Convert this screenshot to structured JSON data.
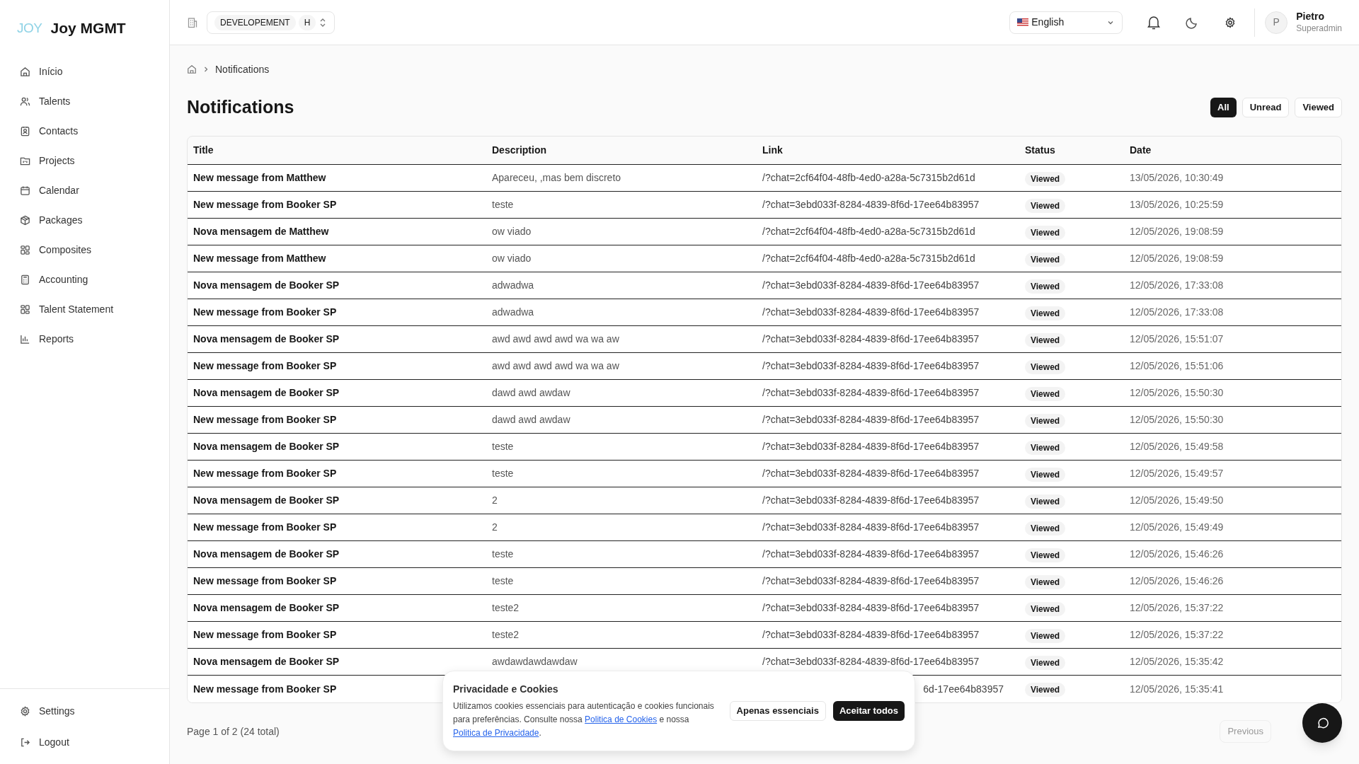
{
  "brand": {
    "mark": "JOY",
    "name": "Joy MGMT"
  },
  "sidebar": {
    "items": [
      {
        "label": "Início"
      },
      {
        "label": "Talents"
      },
      {
        "label": "Contacts"
      },
      {
        "label": "Projects"
      },
      {
        "label": "Calendar"
      },
      {
        "label": "Packages"
      },
      {
        "label": "Composites"
      },
      {
        "label": "Accounting"
      },
      {
        "label": "Talent Statement"
      },
      {
        "label": "Reports"
      }
    ],
    "footer": [
      {
        "label": "Settings"
      },
      {
        "label": "Logout"
      }
    ]
  },
  "topbar": {
    "environment": "DEVELOPEMENT",
    "environment_short": "H",
    "language": "English",
    "user": {
      "initial": "P",
      "name": "Pietro",
      "role": "Superadmin"
    }
  },
  "breadcrumb": [
    "Notifications"
  ],
  "page_title": "Notifications",
  "filters": [
    {
      "label": "All",
      "selected": true
    },
    {
      "label": "Unread",
      "selected": false
    },
    {
      "label": "Viewed",
      "selected": false
    }
  ],
  "table": {
    "columns": [
      "Title",
      "Description",
      "Link",
      "Status",
      "Date"
    ],
    "rows": [
      {
        "title": "New message from Matthew",
        "description": "Apareceu, ,mas bem discreto",
        "link": "/?chat=2cf64f04-48fb-4ed0-a28a-5c7315b2d61d",
        "status": "Viewed",
        "date": "13/05/2026, 10:30:49"
      },
      {
        "title": "New message from Booker SP",
        "description": "teste",
        "link": "/?chat=3ebd033f-8284-4839-8f6d-17ee64b83957",
        "status": "Viewed",
        "date": "13/05/2026, 10:25:59"
      },
      {
        "title": "Nova mensagem de Matthew",
        "description": "ow viado",
        "link": "/?chat=2cf64f04-48fb-4ed0-a28a-5c7315b2d61d",
        "status": "Viewed",
        "date": "12/05/2026, 19:08:59"
      },
      {
        "title": "New message from Matthew",
        "description": "ow viado",
        "link": "/?chat=2cf64f04-48fb-4ed0-a28a-5c7315b2d61d",
        "status": "Viewed",
        "date": "12/05/2026, 19:08:59"
      },
      {
        "title": "Nova mensagem de Booker SP",
        "description": "adwadwa",
        "link": "/?chat=3ebd033f-8284-4839-8f6d-17ee64b83957",
        "status": "Viewed",
        "date": "12/05/2026, 17:33:08"
      },
      {
        "title": "New message from Booker SP",
        "description": "adwadwa",
        "link": "/?chat=3ebd033f-8284-4839-8f6d-17ee64b83957",
        "status": "Viewed",
        "date": "12/05/2026, 17:33:08"
      },
      {
        "title": "Nova mensagem de Booker SP",
        "description": "awd awd awd awd wa wa aw",
        "link": "/?chat=3ebd033f-8284-4839-8f6d-17ee64b83957",
        "status": "Viewed",
        "date": "12/05/2026, 15:51:07"
      },
      {
        "title": "New message from Booker SP",
        "description": "awd awd awd awd wa wa aw",
        "link": "/?chat=3ebd033f-8284-4839-8f6d-17ee64b83957",
        "status": "Viewed",
        "date": "12/05/2026, 15:51:06"
      },
      {
        "title": "Nova mensagem de Booker SP",
        "description": "dawd awd awdaw",
        "link": "/?chat=3ebd033f-8284-4839-8f6d-17ee64b83957",
        "status": "Viewed",
        "date": "12/05/2026, 15:50:30"
      },
      {
        "title": "New message from Booker SP",
        "description": "dawd awd awdaw",
        "link": "/?chat=3ebd033f-8284-4839-8f6d-17ee64b83957",
        "status": "Viewed",
        "date": "12/05/2026, 15:50:30"
      },
      {
        "title": "Nova mensagem de Booker SP",
        "description": "teste",
        "link": "/?chat=3ebd033f-8284-4839-8f6d-17ee64b83957",
        "status": "Viewed",
        "date": "12/05/2026, 15:49:58"
      },
      {
        "title": "New message from Booker SP",
        "description": "teste",
        "link": "/?chat=3ebd033f-8284-4839-8f6d-17ee64b83957",
        "status": "Viewed",
        "date": "12/05/2026, 15:49:57"
      },
      {
        "title": "Nova mensagem de Booker SP",
        "description": "2",
        "link": "/?chat=3ebd033f-8284-4839-8f6d-17ee64b83957",
        "status": "Viewed",
        "date": "12/05/2026, 15:49:50"
      },
      {
        "title": "New message from Booker SP",
        "description": "2",
        "link": "/?chat=3ebd033f-8284-4839-8f6d-17ee64b83957",
        "status": "Viewed",
        "date": "12/05/2026, 15:49:49"
      },
      {
        "title": "Nova mensagem de Booker SP",
        "description": "teste",
        "link": "/?chat=3ebd033f-8284-4839-8f6d-17ee64b83957",
        "status": "Viewed",
        "date": "12/05/2026, 15:46:26"
      },
      {
        "title": "New message from Booker SP",
        "description": "teste",
        "link": "/?chat=3ebd033f-8284-4839-8f6d-17ee64b83957",
        "status": "Viewed",
        "date": "12/05/2026, 15:46:26"
      },
      {
        "title": "Nova mensagem de Booker SP",
        "description": "teste2",
        "link": "/?chat=3ebd033f-8284-4839-8f6d-17ee64b83957",
        "status": "Viewed",
        "date": "12/05/2026, 15:37:22"
      },
      {
        "title": "New message from Booker SP",
        "description": "teste2",
        "link": "/?chat=3ebd033f-8284-4839-8f6d-17ee64b83957",
        "status": "Viewed",
        "date": "12/05/2026, 15:37:22"
      },
      {
        "title": "Nova mensagem de Booker SP",
        "description": "awdawdawdawdaw",
        "link": "/?chat=3ebd033f-8284-4839-8f6d-17ee64b83957",
        "status": "Viewed",
        "date": "12/05/2026, 15:35:42"
      },
      {
        "title": "New message from Booker SP",
        "link": "6d-17ee64b83957",
        "link_cut": true,
        "status": "Viewed",
        "date": "12/05/2026, 15:35:41"
      }
    ]
  },
  "pagination": {
    "summary": "Page 1 of 2 (24 total)",
    "previous": {
      "label": "Previous",
      "disabled": true
    }
  },
  "cookie_banner": {
    "title": "Privacidade e Cookies",
    "text": "Utilizamos cookies essenciais para autenticação e cookies funcionais para preferências. Consulte nossa",
    "link_1": "Politica de Cookies",
    "joiner": "e nossa",
    "link_2": "Politica de Privacidade",
    "end": ".",
    "buttons": [
      {
        "label": "Apenas essenciais",
        "kind": "secondary"
      },
      {
        "label": "Aceitar todos",
        "kind": "primary"
      }
    ]
  }
}
